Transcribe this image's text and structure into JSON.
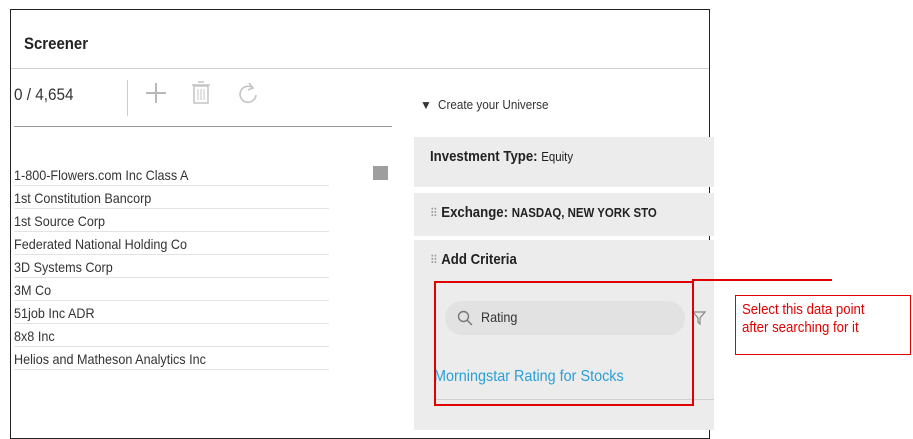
{
  "screener": {
    "title": "Screener",
    "count": "0 / 4,654",
    "tools": {
      "add": "plus-icon",
      "delete": "trash-icon",
      "refresh": "refresh-icon"
    },
    "securities": [
      "1-800-Flowers.com Inc Class A",
      "1st Constitution Bancorp",
      "1st Source Corp",
      "Federated National Holding Co",
      "3D Systems Corp",
      "3M Co",
      "51job Inc ADR",
      "8x8 Inc",
      "Helios and Matheson Analytics Inc"
    ]
  },
  "universe": {
    "toggle_label": "Create your Universe",
    "investment_type": {
      "label": "Investment Type:",
      "value": "Equity"
    },
    "exchange": {
      "label": "Exchange:",
      "value": "NASDAQ, NEW YORK STO"
    },
    "add_criteria": {
      "label": "Add Criteria"
    },
    "search": {
      "value": "Rating"
    },
    "result": "Morningstar Rating for Stocks"
  },
  "annotation": {
    "line1": "Select this data point",
    "line2": "after searching for it"
  },
  "colors": {
    "accent_link": "#2a9fd6",
    "annotation_red": "#e00000",
    "panel_bg": "#ececec"
  }
}
